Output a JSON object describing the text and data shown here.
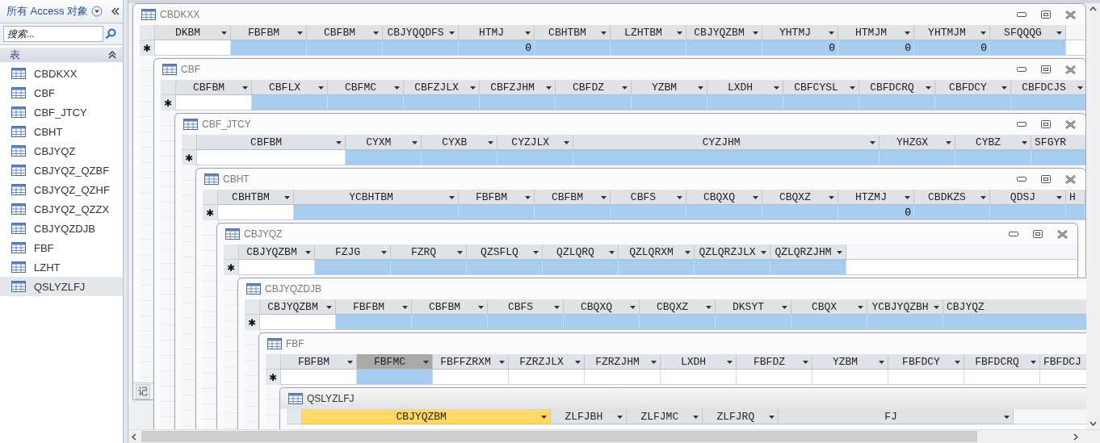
{
  "nav": {
    "title": "所有 Access 对象",
    "search": {
      "placeholder": "搜索..."
    },
    "group": {
      "label": "表",
      "expanded": true
    },
    "items": [
      {
        "label": "CBDKXX",
        "selected": false
      },
      {
        "label": "CBF",
        "selected": false
      },
      {
        "label": "CBF_JTCY",
        "selected": false
      },
      {
        "label": "CBHT",
        "selected": false
      },
      {
        "label": "CBJYQZ",
        "selected": false
      },
      {
        "label": "CBJYQZ_QZBF",
        "selected": false
      },
      {
        "label": "CBJYQZ_QZHF",
        "selected": false
      },
      {
        "label": "CBJYQZ_QZZX",
        "selected": false
      },
      {
        "label": "CBJYQZDJB",
        "selected": false
      },
      {
        "label": "FBF",
        "selected": false
      },
      {
        "label": "LZHT",
        "selected": false
      },
      {
        "label": "QSLYZLFJ",
        "selected": true
      }
    ]
  },
  "windows": [
    {
      "title": "CBDKXX",
      "active": false,
      "new_row_marker": "✱",
      "record_nav": "记",
      "columns": [
        {
          "name": "DKBM",
          "selected": false
        },
        {
          "name": "FBFBM",
          "selected": true
        },
        {
          "name": "CBFBM",
          "selected": true
        },
        {
          "name": "CBJYQQDFS",
          "selected": true
        },
        {
          "name": "HTMJ",
          "selected": true,
          "value": "0"
        },
        {
          "name": "CBHTBM",
          "selected": true
        },
        {
          "name": "LZHTBM",
          "selected": true
        },
        {
          "name": "CBJYQZBM",
          "selected": true
        },
        {
          "name": "YHTMJ",
          "selected": true,
          "value": "0"
        },
        {
          "name": "HTMJM",
          "selected": true,
          "value": "0"
        },
        {
          "name": "YHTMJM",
          "selected": true,
          "value": "0"
        },
        {
          "name": "SFQQQG",
          "selected": true
        }
      ]
    },
    {
      "title": "CBF",
      "active": false,
      "new_row_marker": "✱",
      "columns": [
        {
          "name": "CBFBM",
          "selected": false
        },
        {
          "name": "CBFLX",
          "selected": true
        },
        {
          "name": "CBFMC",
          "selected": true
        },
        {
          "name": "CBFZJLX",
          "selected": true
        },
        {
          "name": "CBFZJHM",
          "selected": true
        },
        {
          "name": "CBFDZ",
          "selected": true
        },
        {
          "name": "YZBM",
          "selected": true
        },
        {
          "name": "LXDH",
          "selected": true
        },
        {
          "name": "CBFCYSL",
          "selected": true
        },
        {
          "name": "CBFDCRQ",
          "selected": true
        },
        {
          "name": "CBFDCY",
          "selected": true
        },
        {
          "name": "CBFDCJS",
          "selected": true
        }
      ]
    },
    {
      "title": "CBF_JTCY",
      "active": false,
      "new_row_marker": "✱",
      "columns": [
        {
          "name": "CBFBM",
          "selected": false
        },
        {
          "name": "CYXM",
          "selected": true
        },
        {
          "name": "CYXB",
          "selected": true
        },
        {
          "name": "CYZJLX",
          "selected": true
        },
        {
          "name": "CYZJHM",
          "selected": true
        },
        {
          "name": "YHZGX",
          "selected": true
        },
        {
          "name": "CYBZ",
          "selected": true
        },
        {
          "name": "SFGYR",
          "selected": true
        }
      ]
    },
    {
      "title": "CBHT",
      "active": false,
      "new_row_marker": "✱",
      "columns": [
        {
          "name": "CBHTBM",
          "selected": false
        },
        {
          "name": "YCBHTBM",
          "selected": true
        },
        {
          "name": "FBFBM",
          "selected": true
        },
        {
          "name": "CBFBM",
          "selected": true
        },
        {
          "name": "CBFS",
          "selected": true
        },
        {
          "name": "CBQXQ",
          "selected": true
        },
        {
          "name": "CBQXZ",
          "selected": true
        },
        {
          "name": "HTZMJ",
          "selected": true,
          "value": "0"
        },
        {
          "name": "CBDKZS",
          "selected": true
        },
        {
          "name": "QDSJ",
          "selected": true
        },
        {
          "name": "H",
          "selected": true
        }
      ]
    },
    {
      "title": "CBJYQZ",
      "active": false,
      "new_row_marker": "✱",
      "columns": [
        {
          "name": "CBJYQZBM",
          "selected": false
        },
        {
          "name": "FZJG",
          "selected": true
        },
        {
          "name": "FZRQ",
          "selected": true
        },
        {
          "name": "QZSFLQ",
          "selected": true
        },
        {
          "name": "QZLQRQ",
          "selected": true
        },
        {
          "name": "QZLQRXM",
          "selected": true
        },
        {
          "name": "QZLQRZJLX",
          "selected": true
        },
        {
          "name": "QZLQRZJHM",
          "selected": true
        }
      ]
    },
    {
      "title": "CBJYQZDJB",
      "active": false,
      "new_row_marker": "✱",
      "columns": [
        {
          "name": "CBJYQZBM",
          "selected": false
        },
        {
          "name": "FBFBM",
          "selected": true
        },
        {
          "name": "CBFBM",
          "selected": true
        },
        {
          "name": "CBFS",
          "selected": true
        },
        {
          "name": "CBQXQ",
          "selected": true
        },
        {
          "name": "CBQXZ",
          "selected": true
        },
        {
          "name": "DKSYT",
          "selected": true
        },
        {
          "name": "CBQX",
          "selected": true
        },
        {
          "name": "YCBJYQZBH",
          "selected": true
        },
        {
          "name": "CBJYQZ",
          "selected": true
        }
      ]
    },
    {
      "title": "FBF",
      "active": false,
      "new_row_marker": "✱",
      "columns": [
        {
          "name": "FBFBM",
          "selected": false,
          "header_pressed": false
        },
        {
          "name": "FBFMC",
          "selected": true,
          "header_pressed": true
        },
        {
          "name": "FBFFZRXM",
          "selected": false,
          "header_pressed": false
        },
        {
          "name": "FZRZJLX",
          "selected": false,
          "header_pressed": false
        },
        {
          "name": "FZRZJHM",
          "selected": false,
          "header_pressed": false
        },
        {
          "name": "LXDH",
          "selected": false,
          "header_pressed": false
        },
        {
          "name": "FBFDZ",
          "selected": false,
          "header_pressed": false
        },
        {
          "name": "YZBM",
          "selected": false,
          "header_pressed": false
        },
        {
          "name": "FBFDCY",
          "selected": false,
          "header_pressed": false
        },
        {
          "name": "FBFDCRQ",
          "selected": false,
          "header_pressed": false
        },
        {
          "name": "FBFDCJ",
          "selected": false,
          "header_pressed": false
        }
      ]
    },
    {
      "title": "QSLYZLFJ",
      "active": true,
      "columns": [
        {
          "name": "CBJYQZBM",
          "hover": true
        },
        {
          "name": "ZLFJBH",
          "hover": false
        },
        {
          "name": "ZLFJMC",
          "hover": false
        },
        {
          "name": "ZLFJRQ",
          "hover": false
        },
        {
          "name": "FJ",
          "hover": false
        }
      ]
    }
  ]
}
